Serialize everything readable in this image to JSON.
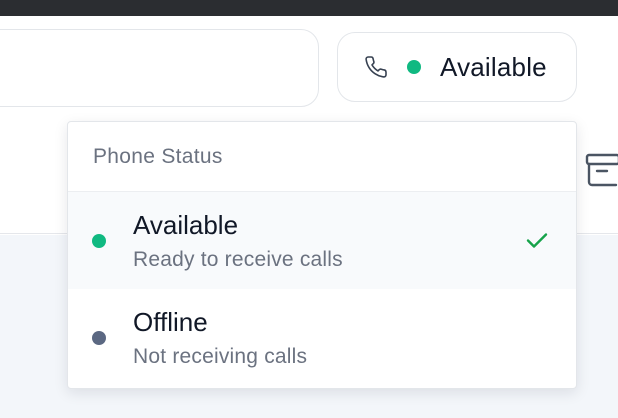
{
  "status_button": {
    "label": "Available",
    "icon": "phone-icon",
    "dot_color": "#10b981"
  },
  "dropdown": {
    "header": "Phone Status",
    "options": [
      {
        "title": "Available",
        "description": "Ready to receive calls",
        "dot_color": "#10b981",
        "selected": true
      },
      {
        "title": "Offline",
        "description": "Not receiving calls",
        "dot_color": "#5b6882",
        "selected": false
      }
    ]
  },
  "icons": {
    "status_phone": "phone-icon",
    "selected_check": "check-icon",
    "archive": "archive-icon"
  },
  "colors": {
    "available": "#10b981",
    "offline": "#5b6882",
    "check": "#16a34a",
    "content_bg": "#f3f6fa"
  }
}
